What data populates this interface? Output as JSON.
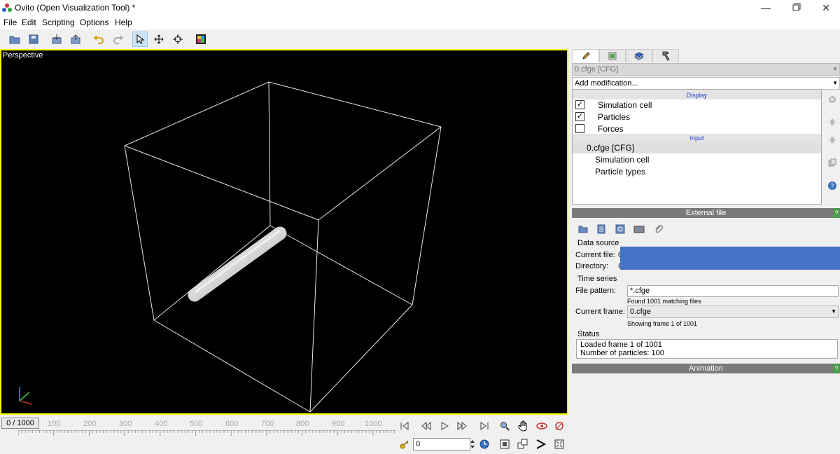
{
  "window": {
    "title": "Ovito (Open Visualization Tool) *"
  },
  "menu": [
    "File",
    "Edit",
    "Scripting",
    "Options",
    "Help"
  ],
  "viewport": {
    "label": "Perspective"
  },
  "timeline": {
    "frame_display": "0 / 1000",
    "ticks": [
      "100",
      "200",
      "300",
      "400",
      "500",
      "600",
      "700",
      "800",
      "900",
      "1000"
    ],
    "spinner_value": "0"
  },
  "panel": {
    "pipeline_combo": "0.cfge [CFG]",
    "add_modification": "Add modification...",
    "display_header": "Display",
    "display_items": [
      {
        "label": "Simulation cell",
        "checked": "✓"
      },
      {
        "label": "Particles",
        "checked": "✓"
      },
      {
        "label": "Forces",
        "checked": ""
      }
    ],
    "input_header": "Input",
    "input_root": "0.cfge [CFG]",
    "input_children": [
      "Simulation cell",
      "Particle types"
    ],
    "external_file": {
      "header": "External file",
      "help": "?",
      "data_source_label": "Data source",
      "current_file_label": "Current file:",
      "current_file_value": "0",
      "directory_label": "Directory:",
      "directory_value": "C",
      "time_series_label": "Time series",
      "file_pattern_label": "File pattern:",
      "file_pattern_value": "*.cfge",
      "found_text": "Found 1001 matching files",
      "current_frame_label": "Current frame:",
      "current_frame_value": "0.cfge",
      "showing_text": "Showing frame 1 of 1001",
      "status_label": "Status",
      "status_line1": "Loaded frame 1 of 1001",
      "status_line2": "Number of particles: 100"
    },
    "animation": {
      "header": "Animation",
      "help": "?"
    }
  },
  "colors": {
    "viewport_border": "#ffff00",
    "rollout_header": "#7a7a7a",
    "redaction": "#4472c4"
  }
}
